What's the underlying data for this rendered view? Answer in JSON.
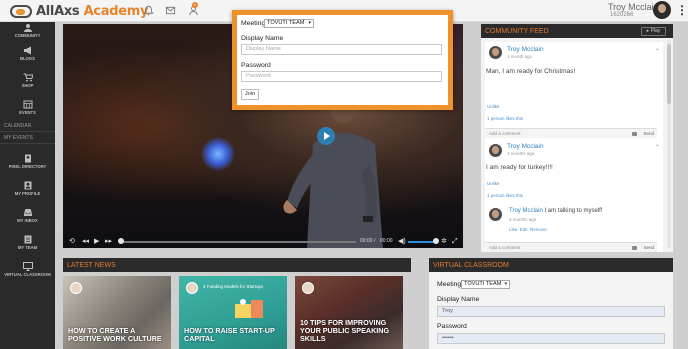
{
  "app": {
    "name_part1": "AllAxs",
    "name_part2": " Academy"
  },
  "user": {
    "name": "Troy Mcclain",
    "id": "1620266"
  },
  "topbar": {
    "notification_count": "1"
  },
  "sidebar": {
    "items": [
      {
        "label": "COMMUNITY"
      },
      {
        "label": "BLOGS"
      },
      {
        "label": "SHOP"
      },
      {
        "label": "EVENTS"
      },
      {
        "label": "PIXEL DIRECTORY"
      },
      {
        "label": "MY PROFILE"
      },
      {
        "label": "MY INBOX"
      },
      {
        "label": "MY TEAM"
      },
      {
        "label": "VIRTUAL CLASSROOM"
      }
    ],
    "calendar": "CALENDAR",
    "my_events": "MY EVENTS"
  },
  "video": {
    "time_current": "00:00",
    "time_total": "00:00",
    "separator": "/"
  },
  "feed": {
    "title": "COMMUNITY FEED",
    "play_label": "Play",
    "posts": [
      {
        "author": "Troy Mcclain",
        "time": "1 month ago",
        "text": "Man, I am ready for Christmas!",
        "like": "Unlike",
        "likes": "1 person likes this",
        "comment_placeholder": "Add a comment",
        "send": "Send"
      },
      {
        "author": "Troy Mcclain",
        "time": "3 months ago",
        "text": "I am ready for turkey!!!!",
        "like": "Unlike",
        "likes": "1 person likes this",
        "reply_author": "Troy Mcclain",
        "reply_text": " I am talking to myself!",
        "reply_time": "3 months ago",
        "reply_actions": "Like  Edit  Remove",
        "comment_placeholder": "Add a comment",
        "send": "Send"
      }
    ]
  },
  "news": {
    "title": "LATEST NEWS",
    "tiles": [
      {
        "title": "HOW TO CREATE A POSITIVE WORK CULTURE",
        "subtitle": ""
      },
      {
        "title": "HOW TO RAISE START-UP CAPITAL",
        "subtitle": "4 Funding Models for Startups"
      },
      {
        "title": "10 TIPS FOR IMPROVING YOUR PUBLIC SPEAKING SKILLS",
        "subtitle": ""
      }
    ]
  },
  "classroom": {
    "title": "VIRTUAL CLASSROOM",
    "meeting_label": "Meeting",
    "meeting_value": "TOVUTI TEAM",
    "display_name_label": "Display Name",
    "display_name_value": "Troy",
    "password_label": "Password",
    "password_value": "••••••"
  },
  "modal": {
    "meeting_label": "Meeting",
    "meeting_value": "TOVUTI TEAM",
    "display_name_label": "Display Name",
    "display_name_placeholder": "Display Name",
    "password_label": "Password",
    "password_placeholder": "Password",
    "join_label": "Join"
  },
  "colors": {
    "accent": "#e6832a",
    "modal_border": "#f0922b",
    "link": "#2f7fc0",
    "panel_header": "#2b2b2b"
  }
}
